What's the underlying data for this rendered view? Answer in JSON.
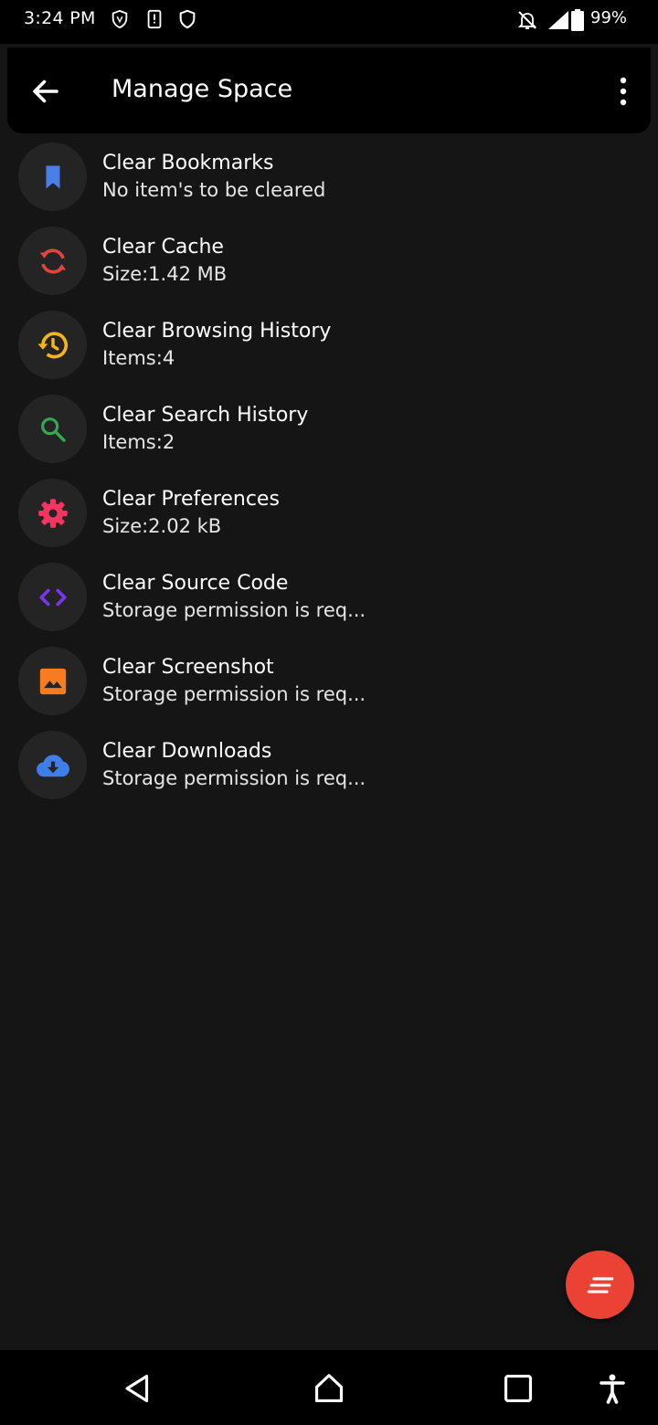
{
  "status_bar": {
    "time": "3:24 PM",
    "battery": "99%",
    "icons": [
      "vpn-shield-icon",
      "phone-alert-icon",
      "shield-icon",
      "notifications-off-icon",
      "signal-icon",
      "battery-icon"
    ]
  },
  "app_bar": {
    "title": "Manage Space",
    "back_icon": "arrow-back-icon",
    "menu_icon": "more-vert-icon"
  },
  "items": [
    {
      "title": "Clear Bookmarks",
      "subtitle": "No item's to be cleared",
      "icon": "bookmark-icon",
      "color": "#4a7fe6"
    },
    {
      "title": "Clear Cache",
      "subtitle": "Size:1.42 MB",
      "icon": "sync-icon",
      "color": "#e0443a"
    },
    {
      "title": "Clear Browsing History",
      "subtitle": "Items:4",
      "icon": "history-icon",
      "color": "#f3b51b"
    },
    {
      "title": "Clear Search History",
      "subtitle": "Items:2",
      "icon": "search-icon",
      "color": "#33a853"
    },
    {
      "title": "Clear Preferences",
      "subtitle": "Size:2.02 kB",
      "icon": "settings-icon",
      "color": "#f3355f"
    },
    {
      "title": "Clear Source Code",
      "subtitle": "Storage permission is req...",
      "icon": "code-icon",
      "color": "#7b35f0"
    },
    {
      "title": "Clear Screenshot",
      "subtitle": "Storage permission is req...",
      "icon": "image-icon",
      "color": "#f57c1f"
    },
    {
      "title": "Clear Downloads",
      "subtitle": "Storage permission is req...",
      "icon": "cloud-download-icon",
      "color": "#3f7ee8"
    }
  ],
  "fab": {
    "icon": "clear-all-icon",
    "color": "#ea4335"
  },
  "nav_bar": {
    "buttons": [
      "back-triangle-icon",
      "home-icon",
      "recents-icon",
      "accessibility-icon"
    ]
  }
}
